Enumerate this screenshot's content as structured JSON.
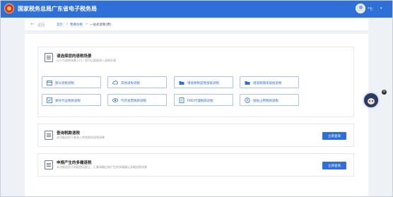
{
  "header": {
    "title": "国家税务总局广东省电子税务局",
    "user_name": "*七",
    "user_menu_icon": "chevron-down-icon",
    "brand_color": "#2f6fd8"
  },
  "breadcrumb": {
    "back_label": "返回",
    "items": [
      "首页",
      "我要办税",
      "一站式退税(费)"
    ],
    "separator": ">"
  },
  "scene_section": {
    "title": "请选择您的退税场景",
    "description": "以下为退税场景入口，您可以直接进入退税办理",
    "buttons": [
      {
        "label": "部分退税退税",
        "icon": "calendar-icon"
      },
      {
        "label": "其他减免退税",
        "icon": "cloud-icon"
      },
      {
        "label": "增值税制度性留抵退税",
        "icon": "folder-icon"
      },
      {
        "label": "增值税期末留抵退税",
        "icon": "folder-icon"
      },
      {
        "label": "委托代征税款退税",
        "icon": "checklist-icon"
      },
      {
        "label": "代开发票税款退税",
        "icon": "eye-icon"
      },
      {
        "label": "PDD代理税款退税",
        "icon": "document-icon"
      },
      {
        "label": "留抵占用税款退税",
        "icon": "cash-icon"
      }
    ]
  },
  "query_section": {
    "title": "查询税款退税",
    "description": "本功能适用于查询入库税款的退税场景",
    "button_label": "立即查询"
  },
  "declare_section": {
    "title": "申报产生的多缴退税",
    "description": "本功能适用于申报错误更正、汇算清缴后账产生的多缴确认多缴退税场景",
    "button_label": "立即查询"
  },
  "assistant": {
    "close_label": "×"
  }
}
